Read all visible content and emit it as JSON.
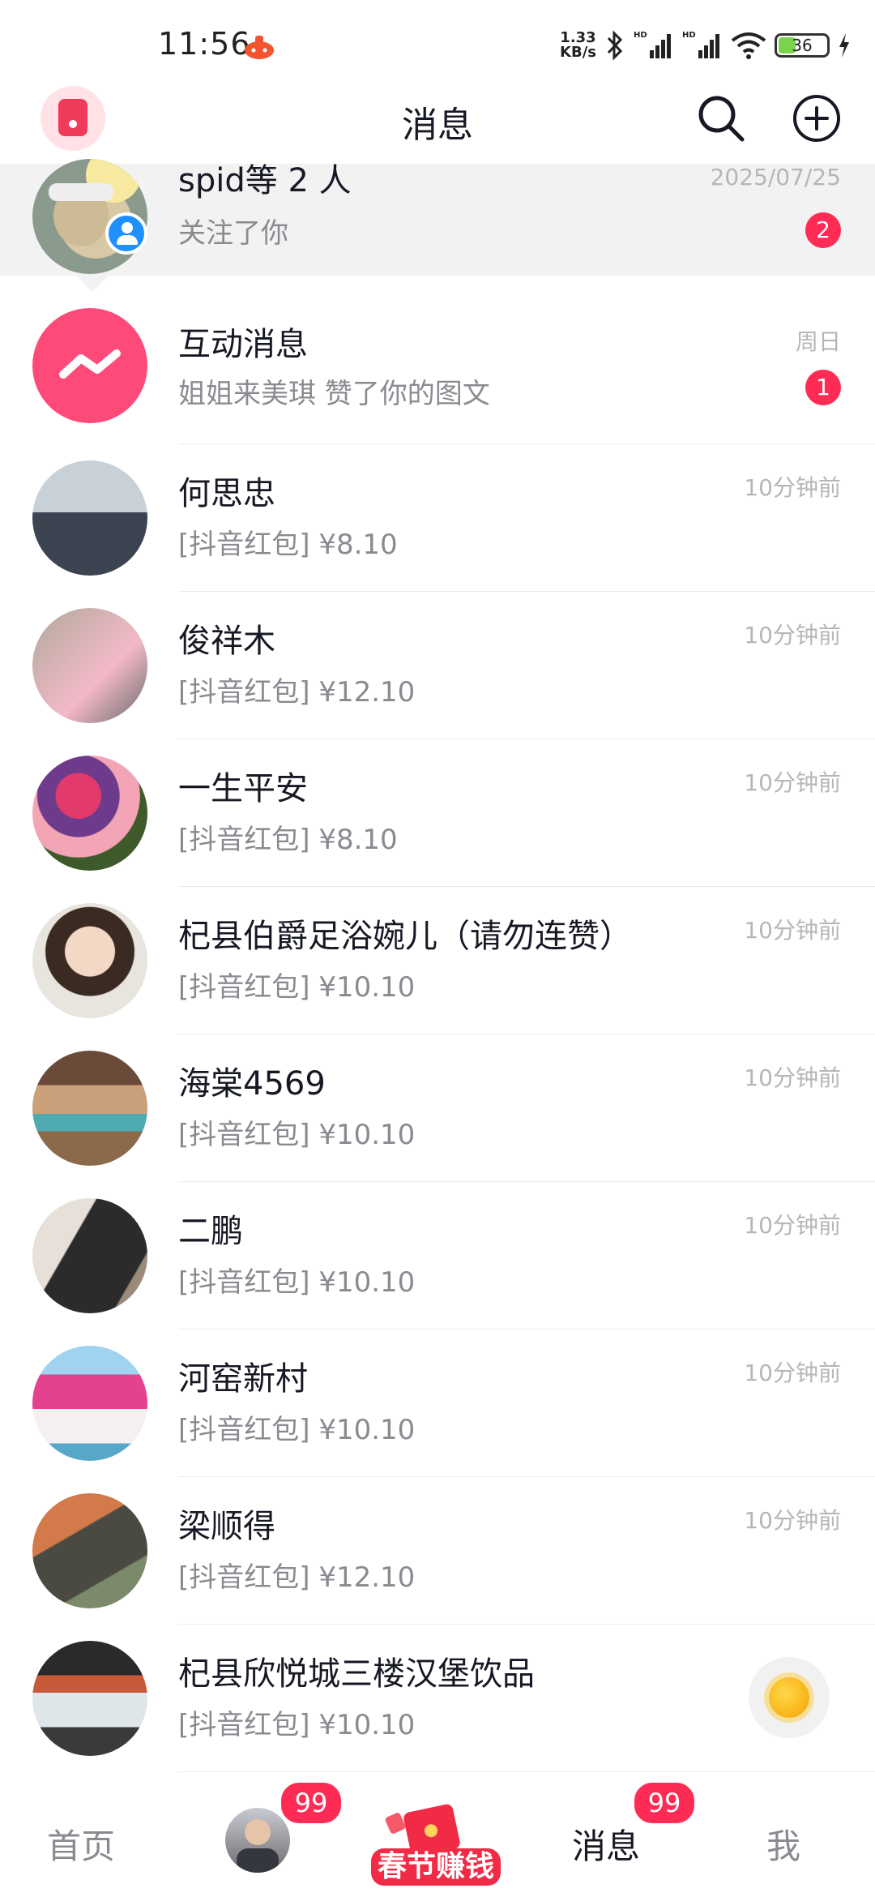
{
  "status_bar": {
    "time": "11:56",
    "net_speed_value": "1.33",
    "net_speed_unit": "KB/s",
    "battery": "36"
  },
  "header": {
    "title": "消息"
  },
  "messages": [
    {
      "name": "spid等 2 人",
      "sub": "关注了你",
      "time": "2025/07/25",
      "badge": "2"
    },
    {
      "name": "互动消息",
      "sub": "姐姐来美琪 赞了你的图文",
      "time": "周日",
      "badge": "1"
    },
    {
      "name": "何思忠",
      "sub": "[抖音红包] ¥8.10",
      "time": "10分钟前"
    },
    {
      "name": "俊祥木",
      "sub": "[抖音红包] ¥12.10",
      "time": "10分钟前"
    },
    {
      "name": "一生平安",
      "sub": "[抖音红包] ¥8.10",
      "time": "10分钟前"
    },
    {
      "name": "杞县伯爵足浴婉儿（请勿连赞）",
      "sub": "[抖音红包] ¥10.10",
      "time": "10分钟前"
    },
    {
      "name": "海棠4569",
      "sub": "[抖音红包] ¥10.10",
      "time": "10分钟前"
    },
    {
      "name": "二鹏",
      "sub": "[抖音红包] ¥10.10",
      "time": "10分钟前"
    },
    {
      "name": "河窑新村",
      "sub": "[抖音红包] ¥10.10",
      "time": "10分钟前"
    },
    {
      "name": "梁顺得",
      "sub": "[抖音红包] ¥12.10",
      "time": "10分钟前"
    },
    {
      "name": "杞县欣悦城三楼汉堡饮品",
      "sub": "[抖音红包] ¥10.10",
      "time": ""
    }
  ],
  "nav": {
    "home": "首页",
    "friends_badge": "99",
    "center": "春节赚钱",
    "messages": "消息",
    "messages_badge": "99",
    "me": "我"
  },
  "colors": {
    "accent": "#fe2c55",
    "muted": "#8a8b91",
    "time": "#b5b6ba"
  },
  "icons": [
    "search-icon",
    "plus-circle-icon",
    "bluetooth-icon",
    "signal-icon",
    "wifi-icon",
    "battery-icon",
    "sun-icon",
    "red-packet-icon"
  ]
}
